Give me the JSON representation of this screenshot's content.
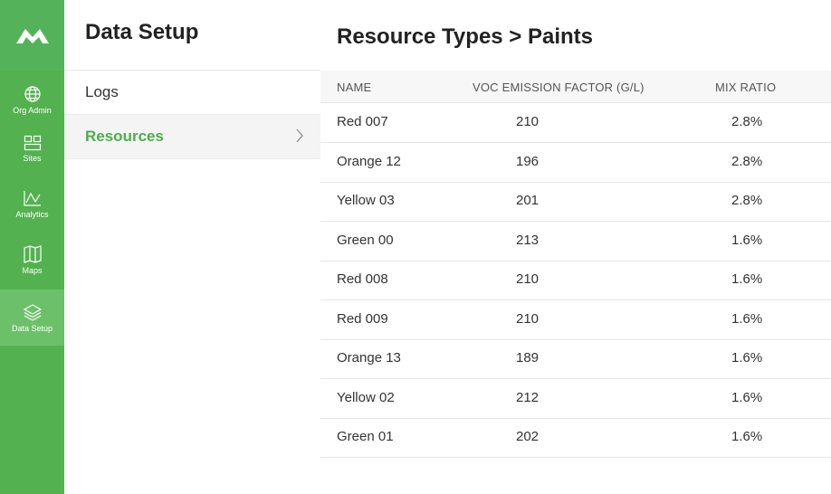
{
  "rail": {
    "items": [
      {
        "label": "Org Admin",
        "icon": "globe-icon"
      },
      {
        "label": "Sites",
        "icon": "grid-icon"
      },
      {
        "label": "Analytics",
        "icon": "chart-icon"
      },
      {
        "label": "Maps",
        "icon": "map-icon"
      },
      {
        "label": "Data Setup",
        "icon": "layers-icon",
        "active": true
      }
    ]
  },
  "sidebar": {
    "title": "Data Setup",
    "items": [
      {
        "label": "Logs"
      },
      {
        "label": "Resources",
        "active": true
      }
    ]
  },
  "main": {
    "title": "Resource Types > Paints",
    "columns": [
      "NAME",
      "VOC EMISSION FACTOR (G/L)",
      "MIX RATIO"
    ],
    "rows": [
      {
        "name": "Red 007",
        "voc": "210",
        "mix": "2.8%"
      },
      {
        "name": "Orange 12",
        "voc": "196",
        "mix": "2.8%"
      },
      {
        "name": "Yellow 03",
        "voc": "201",
        "mix": "2.8%"
      },
      {
        "name": "Green 00",
        "voc": "213",
        "mix": "1.6%"
      },
      {
        "name": "Red 008",
        "voc": "210",
        "mix": "1.6%"
      },
      {
        "name": "Red 009",
        "voc": "210",
        "mix": "1.6%"
      },
      {
        "name": "Orange 13",
        "voc": "189",
        "mix": "1.6%"
      },
      {
        "name": "Yellow 02",
        "voc": "212",
        "mix": "1.6%"
      },
      {
        "name": "Green 01",
        "voc": "202",
        "mix": "1.6%"
      }
    ]
  },
  "colors": {
    "brand_green": "#53b24f",
    "active_green": "#4cae4c"
  }
}
